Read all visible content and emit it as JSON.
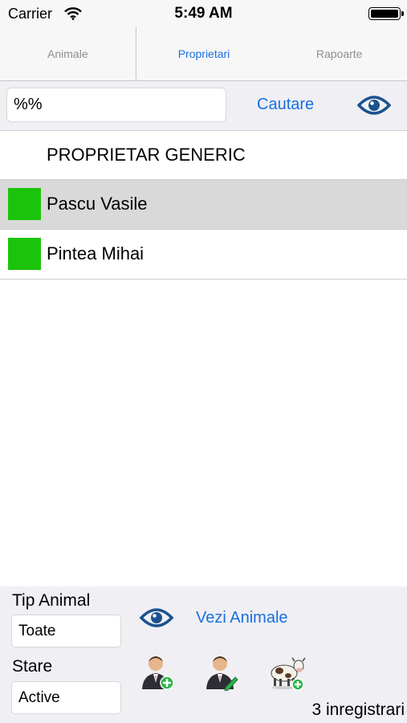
{
  "status_bar": {
    "carrier": "Carrier",
    "time": "5:49 AM"
  },
  "tabs": [
    {
      "label": "Animale",
      "active": false
    },
    {
      "label": "Proprietari",
      "active": true
    },
    {
      "label": "Rapoarte",
      "active": false
    }
  ],
  "search": {
    "value": "%%",
    "button_label": "Cautare",
    "eye_icon": "eye-icon"
  },
  "list": {
    "generic_item": "PROPRIETAR GENERIC",
    "items": [
      {
        "name": "Pascu Vasile",
        "color": "#1bc40a",
        "selected": true
      },
      {
        "name": "Pintea Mihai",
        "color": "#1bc40a",
        "selected": false
      }
    ]
  },
  "filters": {
    "tip_animal_label": "Tip Animal",
    "tip_animal_value": "Toate",
    "stare_label": "Stare",
    "stare_value": "Active",
    "vezi_animale_label": "Vezi Animale"
  },
  "actions": {
    "add_owner_icon": "add-user-icon",
    "edit_owner_icon": "edit-user-icon",
    "add_animal_icon": "add-cow-icon"
  },
  "record_count": "3 inregistrari",
  "colors": {
    "accent": "#1a6fe0",
    "swatch": "#1bc40a",
    "eye": "#1a5290"
  }
}
